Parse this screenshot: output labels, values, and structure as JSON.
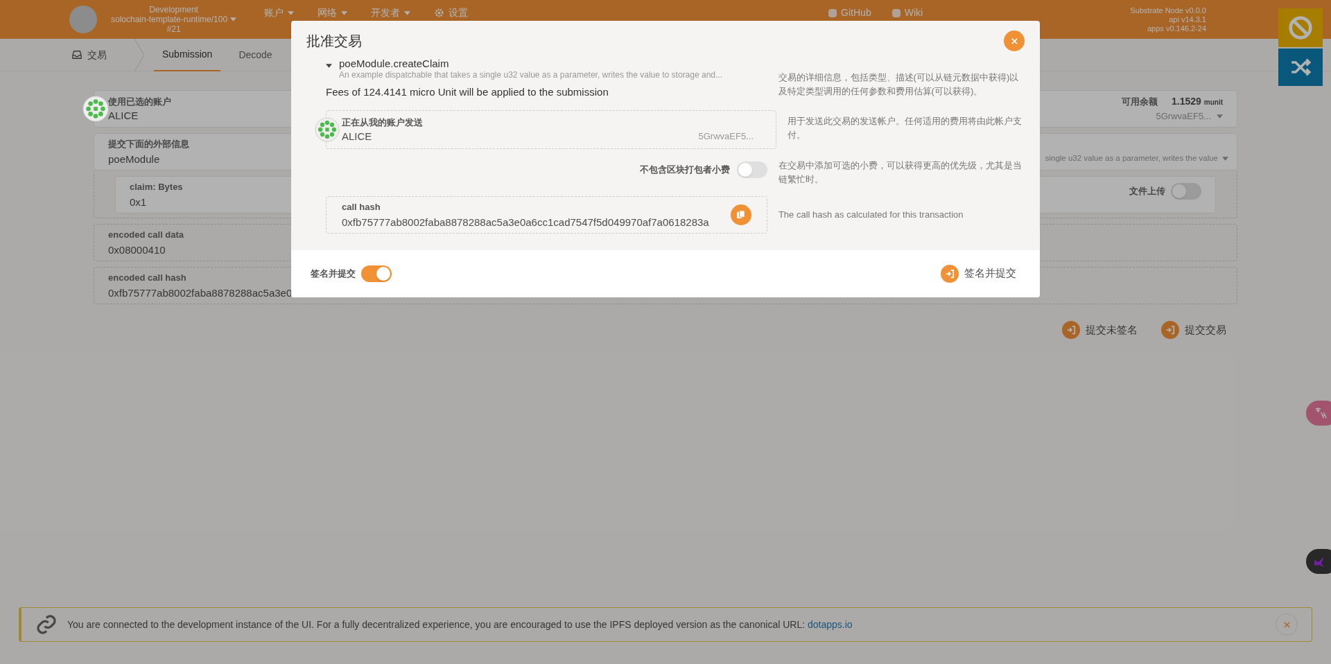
{
  "header": {
    "chain": {
      "name": "Development",
      "runtime": "solochain-template-runtime/100",
      "block": "#21"
    },
    "menu": [
      {
        "label": "账户",
        "kind": "dropdown"
      },
      {
        "label": "网络",
        "kind": "dropdown"
      },
      {
        "label": "开发者",
        "kind": "dropdown"
      },
      {
        "label": "设置",
        "kind": "link"
      }
    ],
    "links": [
      "GitHub",
      "Wiki"
    ],
    "versions": [
      "Substrate Node v0.0.0",
      "api v14.3.1",
      "apps v0.146.2-24"
    ]
  },
  "subnav": {
    "section": "交易",
    "tabs": [
      {
        "label": "Submission",
        "selected": true
      },
      {
        "label": "Decode",
        "selected": false
      }
    ]
  },
  "form": {
    "account": {
      "label": "使用已选的账户",
      "value": "ALICE",
      "balance_label": "可用余额",
      "balance": "1.1529",
      "unit": "munit",
      "address": "5GrwvaEF5..."
    },
    "extrinsic": {
      "label": "提交下面的外部信息",
      "value": "poeModule",
      "description": "single u32 value as a parameter, writes the value"
    },
    "param": {
      "label": "claim: Bytes",
      "value": "0x1",
      "upload_label": "文件上传",
      "upload_on": false
    },
    "encoded_data": {
      "label": "encoded call data",
      "value": "0x08000410"
    },
    "encoded_hash": {
      "label": "encoded call hash",
      "value": "0xfb75777ab8002faba8878288ac5a3e0"
    }
  },
  "actions": [
    "提交未签名",
    "提交交易"
  ],
  "banner": {
    "text": "You are connected to the development instance of the UI. For a fully decentralized experience, you are encouraged to use the IPFS deployed version as the canonical URL:",
    "link": "dotapps.io"
  },
  "modal": {
    "title": "批准交易",
    "call": {
      "name": "poeModule.createClaim",
      "description": "An example dispatchable that takes a single u32 value as a parameter, writes the value to storage and...",
      "fees": "Fees of 124.4141 micro Unit will be applied to the submission",
      "help": "交易的详细信息，包括类型、描述(可以从链元数据中获得)以及特定类型调用的任何参数和费用估算(可以获得)。"
    },
    "sender": {
      "label": "正在从我的账户发送",
      "value": "ALICE",
      "address": "5GrwvaEF5...",
      "help": "用于发送此交易的发送帐户。任何适用的费用将由此帐户支付。"
    },
    "tip": {
      "label": "不包含区块打包者小费",
      "on": false,
      "help": "在交易中添加可选的小费，可以获得更高的优先级，尤其是当链繁忙时。"
    },
    "hash": {
      "label": "call hash",
      "value": "0xfb75777ab8002faba8878288ac5a3e0a6cc1cad7547f5d049970af7a0618283a",
      "help": "The call hash as calculated for this transaction"
    },
    "sign_toggle": {
      "label": "签名并提交",
      "on": true
    },
    "submit": "签名并提交"
  }
}
